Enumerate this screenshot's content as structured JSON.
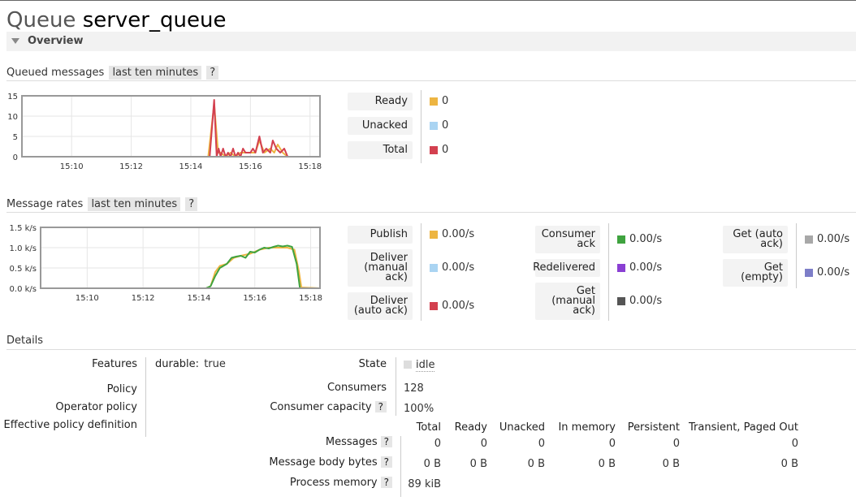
{
  "header": {
    "title_word": "Queue",
    "queue_name": "server_queue",
    "overview_label": "Overview"
  },
  "queued": {
    "title": "Queued messages",
    "range": "last ten minutes",
    "help": "?",
    "legend": [
      {
        "label": "Ready",
        "value": "0",
        "color": "#edb542"
      },
      {
        "label": "Unacked",
        "value": "0",
        "color": "#aad4f2"
      },
      {
        "label": "Total",
        "value": "0",
        "color": "#d3404f"
      }
    ]
  },
  "rates": {
    "title": "Message rates",
    "range": "last ten minutes",
    "help": "?",
    "legend_col1": [
      {
        "label": "Publish",
        "value": "0.00/s",
        "color": "#edb542"
      },
      {
        "label": "Deliver (manual ack)",
        "value": "0.00/s",
        "color": "#aad4f2"
      },
      {
        "label": "Deliver (auto ack)",
        "value": "0.00/s",
        "color": "#d3404f"
      }
    ],
    "legend_col2": [
      {
        "label": "Consumer ack",
        "value": "0.00/s",
        "color": "#3fa33f"
      },
      {
        "label": "Redelivered",
        "value": "0.00/s",
        "color": "#8a3fd3"
      },
      {
        "label": "Get (manual ack)",
        "value": "0.00/s",
        "color": "#555555"
      }
    ],
    "legend_col3": [
      {
        "label": "Get (auto ack)",
        "value": "0.00/s",
        "color": "#a8a8a8"
      },
      {
        "label": "Get (empty)",
        "value": "0.00/s",
        "color": "#7d7ec8"
      }
    ]
  },
  "chart_data": [
    {
      "type": "line",
      "title": "Queued messages",
      "xlabel": "",
      "ylabel": "",
      "xticks": [
        "15:10",
        "15:12",
        "15:14",
        "15:16",
        "15:18"
      ],
      "xrange": [
        "15:08:20",
        "15:18:20"
      ],
      "yticks": [
        "0",
        "5",
        "10",
        "15"
      ],
      "ylim": [
        0,
        15
      ],
      "grid": true,
      "series": [
        {
          "name": "Ready",
          "color": "#edb542",
          "points": [
            [
              "15:08:20",
              0
            ],
            [
              "15:14:35",
              0
            ],
            [
              "15:14:47",
              13
            ],
            [
              "15:14:55",
              1
            ],
            [
              "15:15:00",
              1
            ],
            [
              "15:15:10",
              0
            ],
            [
              "15:15:20",
              1
            ],
            [
              "15:15:30",
              0
            ],
            [
              "15:15:40",
              1
            ],
            [
              "15:16:10",
              1
            ],
            [
              "15:16:18",
              4
            ],
            [
              "15:16:28",
              1
            ],
            [
              "15:16:40",
              2
            ],
            [
              "15:16:48",
              1
            ],
            [
              "15:16:55",
              3
            ],
            [
              "15:17:05",
              1
            ],
            [
              "15:17:15",
              0
            ],
            [
              "15:18:20",
              0
            ]
          ]
        },
        {
          "name": "Total",
          "color": "#d3404f",
          "points": [
            [
              "15:08:20",
              0
            ],
            [
              "15:14:38",
              0
            ],
            [
              "15:14:47",
              14
            ],
            [
              "15:14:52",
              0
            ],
            [
              "15:14:56",
              2
            ],
            [
              "15:15:00",
              0
            ],
            [
              "15:15:05",
              2
            ],
            [
              "15:15:10",
              0
            ],
            [
              "15:15:15",
              1
            ],
            [
              "15:15:20",
              0
            ],
            [
              "15:15:25",
              2
            ],
            [
              "15:15:30",
              0
            ],
            [
              "15:15:35",
              1
            ],
            [
              "15:15:40",
              0
            ],
            [
              "15:15:45",
              2
            ],
            [
              "15:15:50",
              1
            ],
            [
              "15:16:00",
              1
            ],
            [
              "15:16:05",
              2
            ],
            [
              "15:16:10",
              1
            ],
            [
              "15:16:18",
              5
            ],
            [
              "15:16:25",
              1
            ],
            [
              "15:16:32",
              2
            ],
            [
              "15:16:40",
              1
            ],
            [
              "15:16:45",
              4
            ],
            [
              "15:16:52",
              2
            ],
            [
              "15:17:00",
              1
            ],
            [
              "15:17:08",
              2
            ],
            [
              "15:17:15",
              0
            ],
            [
              "15:18:20",
              0
            ]
          ]
        }
      ]
    },
    {
      "type": "line",
      "title": "Message rates",
      "xlabel": "",
      "ylabel": "",
      "xticks": [
        "15:10",
        "15:12",
        "15:14",
        "15:16",
        "15:18"
      ],
      "xrange": [
        "15:08:20",
        "15:18:20"
      ],
      "yticks": [
        "0.0 k/s",
        "0.5 k/s",
        "1.0 k/s",
        "1.5 k/s"
      ],
      "ylim": [
        0,
        1.5
      ],
      "grid": true,
      "series": [
        {
          "name": "Publish",
          "color": "#edb542",
          "points": [
            [
              "15:08:20",
              0
            ],
            [
              "15:14:15",
              0
            ],
            [
              "15:14:25",
              0.05
            ],
            [
              "15:14:35",
              0.4
            ],
            [
              "15:14:45",
              0.55
            ],
            [
              "15:15:00",
              0.6
            ],
            [
              "15:15:15",
              0.75
            ],
            [
              "15:15:30",
              0.8
            ],
            [
              "15:15:50",
              0.85
            ],
            [
              "15:16:10",
              0.95
            ],
            [
              "15:16:30",
              1.0
            ],
            [
              "15:16:50",
              1.0
            ],
            [
              "15:17:10",
              1.0
            ],
            [
              "15:17:25",
              0.95
            ],
            [
              "15:17:35",
              0.4
            ],
            [
              "15:17:40",
              0.02
            ],
            [
              "15:18:20",
              0
            ]
          ]
        },
        {
          "name": "Consumer ack",
          "color": "#3fa33f",
          "points": [
            [
              "15:08:20",
              0
            ],
            [
              "15:14:15",
              0
            ],
            [
              "15:14:25",
              0.05
            ],
            [
              "15:14:35",
              0.3
            ],
            [
              "15:14:45",
              0.5
            ],
            [
              "15:15:00",
              0.6
            ],
            [
              "15:15:10",
              0.75
            ],
            [
              "15:15:20",
              0.78
            ],
            [
              "15:15:30",
              0.8
            ],
            [
              "15:15:40",
              0.75
            ],
            [
              "15:15:50",
              0.9
            ],
            [
              "15:16:00",
              0.88
            ],
            [
              "15:16:10",
              0.95
            ],
            [
              "15:16:20",
              1.0
            ],
            [
              "15:16:30",
              0.98
            ],
            [
              "15:16:40",
              1.02
            ],
            [
              "15:16:50",
              1.05
            ],
            [
              "15:17:00",
              1.03
            ],
            [
              "15:17:10",
              1.05
            ],
            [
              "15:17:20",
              1.02
            ],
            [
              "15:17:30",
              0.6
            ],
            [
              "15:17:37",
              0
            ],
            [
              "15:18:20",
              0
            ]
          ]
        },
        {
          "name": "Get (empty)",
          "color": "#7d7ec8",
          "points": [
            [
              "15:08:20",
              0
            ],
            [
              "15:18:20",
              0
            ]
          ]
        }
      ]
    }
  ],
  "details": {
    "title": "Details",
    "left_labels": [
      "Features",
      "Policy",
      "Operator policy",
      "Effective policy definition"
    ],
    "feature_key": "durable:",
    "feature_val": "true",
    "state_label": "State",
    "state_value": "idle",
    "consumers_label": "Consumers",
    "consumers_value": "128",
    "capacity_label": "Consumer capacity",
    "capacity_value": "100%",
    "help": "?",
    "columns": [
      "Total",
      "Ready",
      "Unacked",
      "In memory",
      "Persistent",
      "Transient, Paged Out"
    ],
    "rows": [
      {
        "label": "Messages",
        "values": [
          "0",
          "0",
          "0",
          "0",
          "0",
          "0"
        ]
      },
      {
        "label": "Message body bytes",
        "values": [
          "0 B",
          "0 B",
          "0 B",
          "0 B",
          "0 B",
          "0 B"
        ]
      },
      {
        "label": "Process memory",
        "values": [
          "89 kiB"
        ]
      }
    ]
  }
}
